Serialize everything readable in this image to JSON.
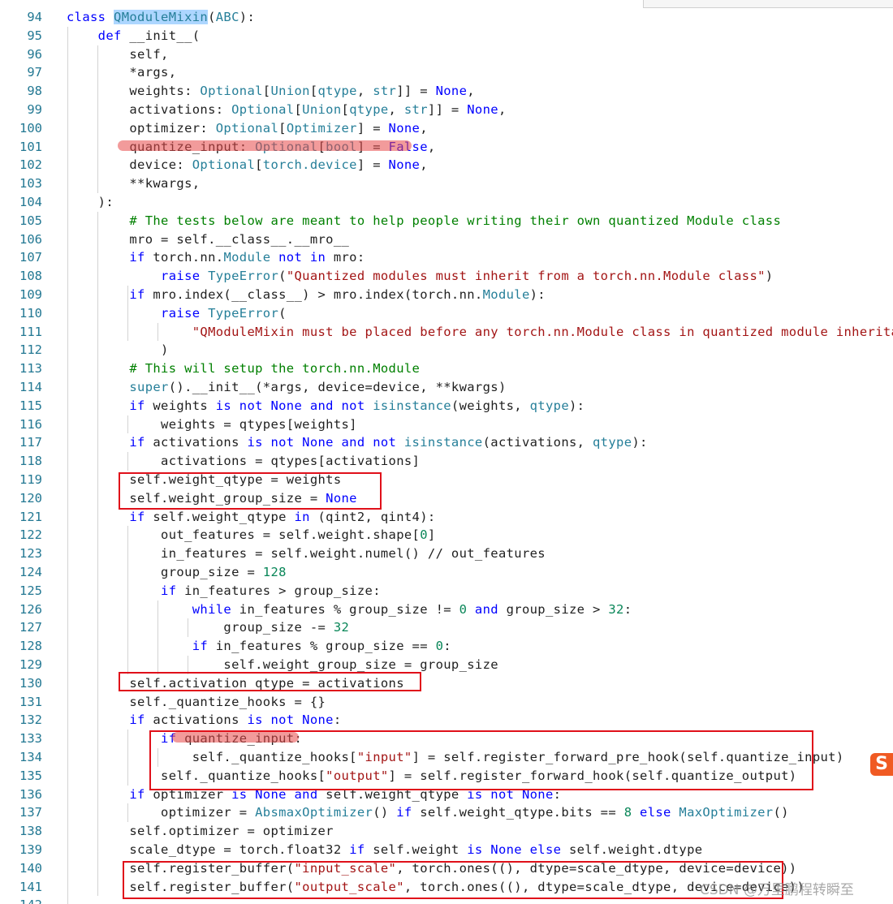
{
  "editor": {
    "lines": [
      {
        "n": "94",
        "tokens": [
          {
            "t": "class ",
            "c": "k"
          },
          {
            "t": "QModuleMixin",
            "c": "t hl"
          },
          {
            "t": "(",
            "c": ""
          },
          {
            "t": "ABC",
            "c": "t"
          },
          {
            "t": "):",
            "c": ""
          }
        ]
      },
      {
        "n": "95",
        "tokens": [
          {
            "t": "    def ",
            "c": "k"
          },
          {
            "t": "__init__",
            "c": ""
          },
          {
            "t": "(",
            "c": ""
          }
        ]
      },
      {
        "n": "96",
        "tokens": [
          {
            "t": "        self,",
            "c": ""
          }
        ]
      },
      {
        "n": "97",
        "tokens": [
          {
            "t": "        *args,",
            "c": ""
          }
        ]
      },
      {
        "n": "98",
        "tokens": [
          {
            "t": "        weights: ",
            "c": ""
          },
          {
            "t": "Optional",
            "c": "t"
          },
          {
            "t": "[",
            "c": ""
          },
          {
            "t": "Union",
            "c": "t"
          },
          {
            "t": "[",
            "c": ""
          },
          {
            "t": "qtype",
            "c": "t"
          },
          {
            "t": ", ",
            "c": ""
          },
          {
            "t": "str",
            "c": "t"
          },
          {
            "t": "]] = ",
            "c": ""
          },
          {
            "t": "None",
            "c": "k"
          },
          {
            "t": ",",
            "c": ""
          }
        ]
      },
      {
        "n": "99",
        "tokens": [
          {
            "t": "        activations: ",
            "c": ""
          },
          {
            "t": "Optional",
            "c": "t"
          },
          {
            "t": "[",
            "c": ""
          },
          {
            "t": "Union",
            "c": "t"
          },
          {
            "t": "[",
            "c": ""
          },
          {
            "t": "qtype",
            "c": "t"
          },
          {
            "t": ", ",
            "c": ""
          },
          {
            "t": "str",
            "c": "t"
          },
          {
            "t": "]] = ",
            "c": ""
          },
          {
            "t": "None",
            "c": "k"
          },
          {
            "t": ",",
            "c": ""
          }
        ]
      },
      {
        "n": "100",
        "tokens": [
          {
            "t": "        optimizer: ",
            "c": ""
          },
          {
            "t": "Optional",
            "c": "t"
          },
          {
            "t": "[",
            "c": ""
          },
          {
            "t": "Optimizer",
            "c": "t"
          },
          {
            "t": "] = ",
            "c": ""
          },
          {
            "t": "None",
            "c": "k"
          },
          {
            "t": ",",
            "c": ""
          }
        ]
      },
      {
        "n": "101",
        "tokens": [
          {
            "t": "        quantize_input: ",
            "c": ""
          },
          {
            "t": "Optional",
            "c": "t"
          },
          {
            "t": "[",
            "c": ""
          },
          {
            "t": "bool",
            "c": "t"
          },
          {
            "t": "] = ",
            "c": ""
          },
          {
            "t": "False",
            "c": "k"
          },
          {
            "t": ",",
            "c": ""
          }
        ]
      },
      {
        "n": "102",
        "tokens": [
          {
            "t": "        device: ",
            "c": ""
          },
          {
            "t": "Optional",
            "c": "t"
          },
          {
            "t": "[",
            "c": ""
          },
          {
            "t": "torch.device",
            "c": "t"
          },
          {
            "t": "] = ",
            "c": ""
          },
          {
            "t": "None",
            "c": "k"
          },
          {
            "t": ",",
            "c": ""
          }
        ]
      },
      {
        "n": "103",
        "tokens": [
          {
            "t": "        **kwargs,",
            "c": ""
          }
        ]
      },
      {
        "n": "104",
        "tokens": [
          {
            "t": "    ):",
            "c": ""
          }
        ]
      },
      {
        "n": "105",
        "tokens": [
          {
            "t": "        # The tests below are meant to help people writing their own quantized Module class",
            "c": "c"
          }
        ]
      },
      {
        "n": "106",
        "tokens": [
          {
            "t": "        mro = self.__class__.__mro__",
            "c": ""
          }
        ]
      },
      {
        "n": "107",
        "tokens": [
          {
            "t": "        if ",
            "c": "k"
          },
          {
            "t": "torch.nn.",
            "c": ""
          },
          {
            "t": "Module",
            "c": "t"
          },
          {
            "t": " not in ",
            "c": "k"
          },
          {
            "t": "mro:",
            "c": ""
          }
        ]
      },
      {
        "n": "108",
        "tokens": [
          {
            "t": "            raise ",
            "c": "k"
          },
          {
            "t": "TypeError",
            "c": "t"
          },
          {
            "t": "(",
            "c": ""
          },
          {
            "t": "\"Quantized modules must inherit from a torch.nn.Module class\"",
            "c": "s"
          },
          {
            "t": ")",
            "c": ""
          }
        ]
      },
      {
        "n": "109",
        "tokens": [
          {
            "t": "        if ",
            "c": "k"
          },
          {
            "t": "mro.index(__class__) > mro.index(torch.nn.",
            "c": ""
          },
          {
            "t": "Module",
            "c": "t"
          },
          {
            "t": "):",
            "c": ""
          }
        ]
      },
      {
        "n": "110",
        "tokens": [
          {
            "t": "            raise ",
            "c": "k"
          },
          {
            "t": "TypeError",
            "c": "t"
          },
          {
            "t": "(",
            "c": ""
          }
        ]
      },
      {
        "n": "111",
        "tokens": [
          {
            "t": "                \"QModuleMixin must be placed before any torch.nn.Module class in quantized module inheritance.\"",
            "c": "s"
          }
        ]
      },
      {
        "n": "112",
        "tokens": [
          {
            "t": "            )",
            "c": ""
          }
        ]
      },
      {
        "n": "113",
        "tokens": [
          {
            "t": "        # This will setup the torch.nn.Module",
            "c": "c"
          }
        ]
      },
      {
        "n": "114",
        "tokens": [
          {
            "t": "        super",
            "c": "t"
          },
          {
            "t": "().__init__(*args, device=device, **kwargs)",
            "c": ""
          }
        ]
      },
      {
        "n": "115",
        "tokens": [
          {
            "t": "        if ",
            "c": "k"
          },
          {
            "t": "weights ",
            "c": ""
          },
          {
            "t": "is not None and not ",
            "c": "k"
          },
          {
            "t": "isinstance",
            "c": "t"
          },
          {
            "t": "(weights, ",
            "c": ""
          },
          {
            "t": "qtype",
            "c": "t"
          },
          {
            "t": "):",
            "c": ""
          }
        ]
      },
      {
        "n": "116",
        "tokens": [
          {
            "t": "            weights = qtypes[weights]",
            "c": ""
          }
        ]
      },
      {
        "n": "117",
        "tokens": [
          {
            "t": "        if ",
            "c": "k"
          },
          {
            "t": "activations ",
            "c": ""
          },
          {
            "t": "is not None and not ",
            "c": "k"
          },
          {
            "t": "isinstance",
            "c": "t"
          },
          {
            "t": "(activations, ",
            "c": ""
          },
          {
            "t": "qtype",
            "c": "t"
          },
          {
            "t": "):",
            "c": ""
          }
        ]
      },
      {
        "n": "118",
        "tokens": [
          {
            "t": "            activations = qtypes[activations]",
            "c": ""
          }
        ]
      },
      {
        "n": "119",
        "tokens": [
          {
            "t": "        self.weight_qtype = weights",
            "c": ""
          }
        ]
      },
      {
        "n": "120",
        "tokens": [
          {
            "t": "        self.weight_group_size = ",
            "c": ""
          },
          {
            "t": "None",
            "c": "k"
          }
        ]
      },
      {
        "n": "121",
        "tokens": [
          {
            "t": "        if ",
            "c": "k"
          },
          {
            "t": "self.weight_qtype ",
            "c": ""
          },
          {
            "t": "in ",
            "c": "k"
          },
          {
            "t": "(qint2, qint4):",
            "c": ""
          }
        ]
      },
      {
        "n": "122",
        "tokens": [
          {
            "t": "            out_features = self.weight.shape[",
            "c": ""
          },
          {
            "t": "0",
            "c": "n"
          },
          {
            "t": "]",
            "c": ""
          }
        ]
      },
      {
        "n": "123",
        "tokens": [
          {
            "t": "            in_features = self.weight.numel() // out_features",
            "c": ""
          }
        ]
      },
      {
        "n": "124",
        "tokens": [
          {
            "t": "            group_size = ",
            "c": ""
          },
          {
            "t": "128",
            "c": "n"
          }
        ]
      },
      {
        "n": "125",
        "tokens": [
          {
            "t": "            if ",
            "c": "k"
          },
          {
            "t": "in_features > group_size:",
            "c": ""
          }
        ]
      },
      {
        "n": "126",
        "tokens": [
          {
            "t": "                while ",
            "c": "k"
          },
          {
            "t": "in_features % group_size != ",
            "c": ""
          },
          {
            "t": "0",
            "c": "n"
          },
          {
            "t": " and ",
            "c": "k"
          },
          {
            "t": "group_size > ",
            "c": ""
          },
          {
            "t": "32",
            "c": "n"
          },
          {
            "t": ":",
            "c": ""
          }
        ]
      },
      {
        "n": "127",
        "tokens": [
          {
            "t": "                    group_size -= ",
            "c": ""
          },
          {
            "t": "32",
            "c": "n"
          }
        ]
      },
      {
        "n": "128",
        "tokens": [
          {
            "t": "                if ",
            "c": "k"
          },
          {
            "t": "in_features % group_size == ",
            "c": ""
          },
          {
            "t": "0",
            "c": "n"
          },
          {
            "t": ":",
            "c": ""
          }
        ]
      },
      {
        "n": "129",
        "tokens": [
          {
            "t": "                    self.weight_group_size = group_size",
            "c": ""
          }
        ]
      },
      {
        "n": "130",
        "tokens": [
          {
            "t": "        self.activation_qtype = activations",
            "c": ""
          }
        ]
      },
      {
        "n": "131",
        "tokens": [
          {
            "t": "        self._quantize_hooks = {}",
            "c": ""
          }
        ]
      },
      {
        "n": "132",
        "tokens": [
          {
            "t": "        if ",
            "c": "k"
          },
          {
            "t": "activations ",
            "c": ""
          },
          {
            "t": "is not None",
            "c": "k"
          },
          {
            "t": ":",
            "c": ""
          }
        ]
      },
      {
        "n": "133",
        "tokens": [
          {
            "t": "            if ",
            "c": "k"
          },
          {
            "t": "quantize_input:",
            "c": ""
          }
        ]
      },
      {
        "n": "134",
        "tokens": [
          {
            "t": "                self._quantize_hooks[",
            "c": ""
          },
          {
            "t": "\"input\"",
            "c": "s"
          },
          {
            "t": "] = self.register_forward_pre_hook(self.quantize_input)",
            "c": ""
          }
        ]
      },
      {
        "n": "135",
        "tokens": [
          {
            "t": "            self._quantize_hooks[",
            "c": ""
          },
          {
            "t": "\"output\"",
            "c": "s"
          },
          {
            "t": "] = self.register_forward_hook(self.quantize_output)",
            "c": ""
          }
        ]
      },
      {
        "n": "136",
        "tokens": [
          {
            "t": "        if ",
            "c": "k"
          },
          {
            "t": "optimizer ",
            "c": ""
          },
          {
            "t": "is None and ",
            "c": "k"
          },
          {
            "t": "self.weight_qtype ",
            "c": ""
          },
          {
            "t": "is not None",
            "c": "k"
          },
          {
            "t": ":",
            "c": ""
          }
        ]
      },
      {
        "n": "137",
        "tokens": [
          {
            "t": "            optimizer = ",
            "c": ""
          },
          {
            "t": "AbsmaxOptimizer",
            "c": "t"
          },
          {
            "t": "() ",
            "c": ""
          },
          {
            "t": "if ",
            "c": "k"
          },
          {
            "t": "self.weight_qtype.bits == ",
            "c": ""
          },
          {
            "t": "8",
            "c": "n"
          },
          {
            "t": " else ",
            "c": "k"
          },
          {
            "t": "MaxOptimizer",
            "c": "t"
          },
          {
            "t": "()",
            "c": ""
          }
        ]
      },
      {
        "n": "138",
        "tokens": [
          {
            "t": "        self.optimizer = optimizer",
            "c": ""
          }
        ]
      },
      {
        "n": "139",
        "tokens": [
          {
            "t": "        scale_dtype = torch.float32 ",
            "c": ""
          },
          {
            "t": "if ",
            "c": "k"
          },
          {
            "t": "self.weight ",
            "c": ""
          },
          {
            "t": "is None else ",
            "c": "k"
          },
          {
            "t": "self.weight.dtype",
            "c": ""
          }
        ]
      },
      {
        "n": "140",
        "tokens": [
          {
            "t": "        self.register_buffer(",
            "c": ""
          },
          {
            "t": "\"input_scale\"",
            "c": "s"
          },
          {
            "t": ", torch.ones((), dtype=scale_dtype, device=device))",
            "c": ""
          }
        ]
      },
      {
        "n": "141",
        "tokens": [
          {
            "t": "        self.register_buffer(",
            "c": ""
          },
          {
            "t": "\"output_scale\"",
            "c": "s"
          },
          {
            "t": ", torch.ones((), dtype=scale_dtype, device=device))",
            "c": ""
          }
        ]
      },
      {
        "n": "142",
        "tokens": []
      }
    ]
  },
  "overlay": {
    "sogou_label": "S",
    "watermark": "CSDN @万里鹏程转瞬至"
  },
  "colors": {
    "keyword": "#0000ff",
    "comment": "#008000",
    "string": "#a31515",
    "type": "#267f99",
    "number": "#098658",
    "annotation_red": "#e0101a"
  }
}
